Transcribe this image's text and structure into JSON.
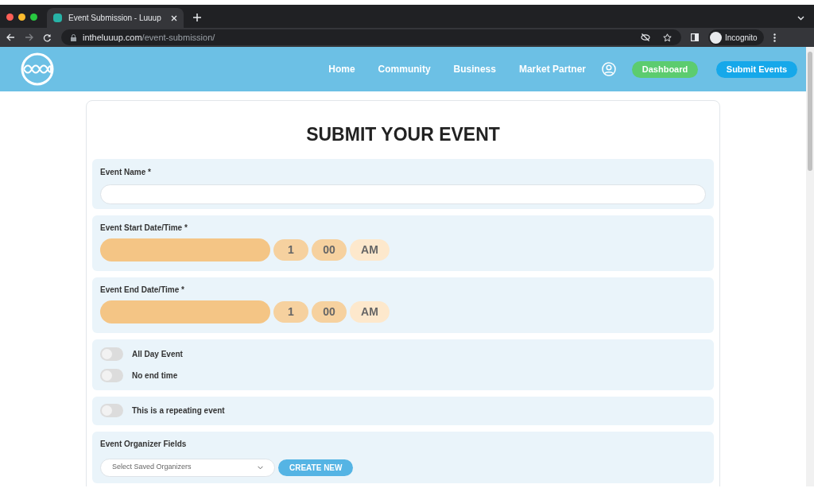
{
  "browser": {
    "tab_title": "Event Submission - Luuup",
    "url_domain": "intheluuup.com",
    "url_path": "/event-submission/",
    "profile": "Incognito"
  },
  "nav": {
    "links": [
      "Home",
      "Community",
      "Business",
      "Market Partner"
    ],
    "dashboard": "Dashboard",
    "submit": "Submit Events"
  },
  "form": {
    "title": "SUBMIT YOUR EVENT",
    "event_name": {
      "label": "Event Name *"
    },
    "start": {
      "label": "Event Start Date/Time *",
      "hour": "1",
      "minute": "00",
      "period": "AM"
    },
    "end": {
      "label": "Event End Date/Time *",
      "hour": "1",
      "minute": "00",
      "period": "AM"
    },
    "toggle_groups": [
      [
        {
          "label": "All Day Event",
          "on": false
        },
        {
          "label": "No end time",
          "on": false
        }
      ],
      [
        {
          "label": "This is a repeating event",
          "on": false
        }
      ]
    ],
    "organizer": {
      "label": "Event Organizer Fields",
      "placeholder": "Select Saved Organizers",
      "button": "CREATE NEW"
    }
  }
}
